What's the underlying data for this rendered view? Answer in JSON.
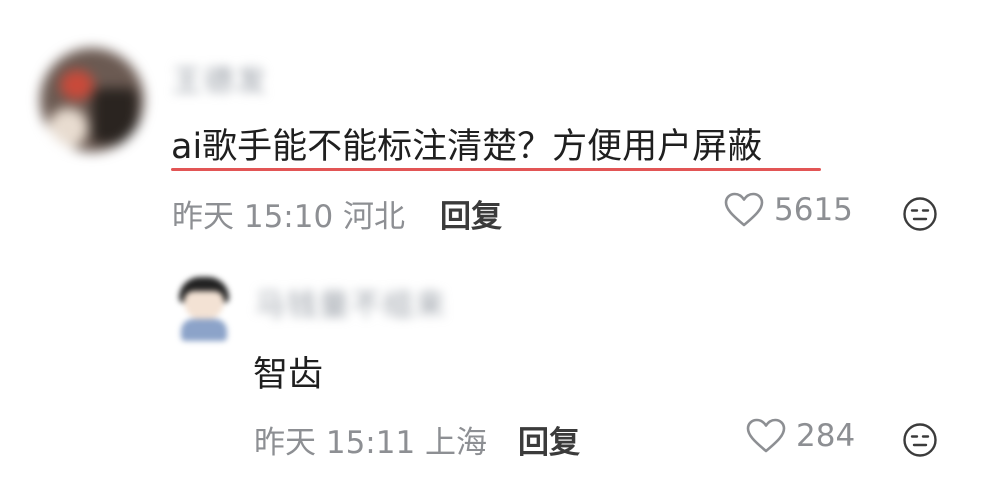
{
  "comment": {
    "author": "王德发",
    "text": "ai歌手能不能标注清楚？方便用户屏蔽",
    "meta": "昨天 15:10 河北",
    "reply_label": "回复",
    "likes": "5615",
    "like_icon": "heart-outline-icon",
    "reaction_icon": "neutral-face-icon"
  },
  "reply": {
    "author": "马钱量不组来",
    "text": "智齿",
    "meta": "昨天 15:11 上海",
    "reply_label": "回复",
    "likes": "284",
    "like_icon": "heart-outline-icon",
    "reaction_icon": "neutral-face-icon"
  },
  "colors": {
    "underline": "#e25555",
    "meta_text": "#8d8f93",
    "body_text": "#1f1f1f"
  }
}
